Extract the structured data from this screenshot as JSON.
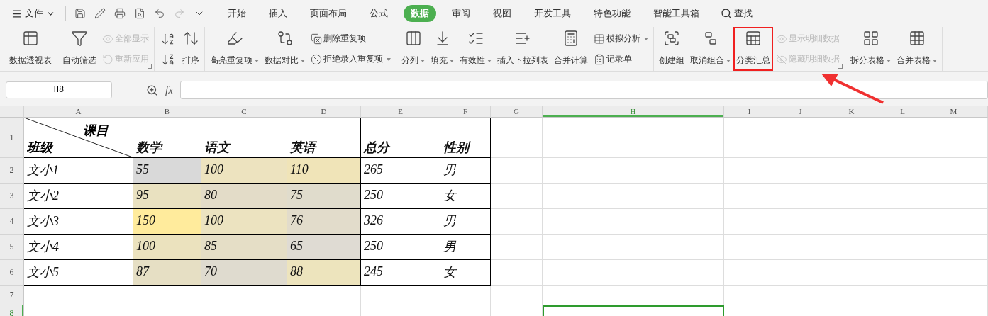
{
  "menu": {
    "file": "文件"
  },
  "quick_access": [
    {
      "disabled": false
    },
    {
      "disabled": false
    },
    {
      "disabled": false
    },
    {
      "disabled": false
    },
    {
      "disabled": false
    },
    {
      "disabled": true
    },
    {
      "disabled": false
    }
  ],
  "tabs": [
    {
      "label": "开始",
      "selected": false
    },
    {
      "label": "插入",
      "selected": false
    },
    {
      "label": "页面布局",
      "selected": false
    },
    {
      "label": "公式",
      "selected": false
    },
    {
      "label": "数据",
      "selected": true
    },
    {
      "label": "审阅",
      "selected": false
    },
    {
      "label": "视图",
      "selected": false
    },
    {
      "label": "开发工具",
      "selected": false
    },
    {
      "label": "特色功能",
      "selected": false
    },
    {
      "label": "智能工具箱",
      "selected": false
    }
  ],
  "search": {
    "label": "查找"
  },
  "ribbon": {
    "groups": [
      {
        "launcher": false,
        "columns": [
          {
            "kind": "large",
            "label": "数据透视表",
            "dropdown": false,
            "highlighted": false
          }
        ]
      },
      {
        "launcher": true,
        "columns": [
          {
            "kind": "large",
            "label": "自动筛选",
            "dropdown": false,
            "highlighted": false
          },
          {
            "kind": "stack",
            "items": [
              {
                "label": "全部显示",
                "disabled": true,
                "dropdown": false
              },
              {
                "label": "重新应用",
                "disabled": true,
                "dropdown": false
              }
            ]
          }
        ]
      },
      {
        "launcher": false,
        "columns": [
          {
            "kind": "icons",
            "items": [
              {
                "disabled": false
              },
              {
                "disabled": false
              }
            ]
          },
          {
            "kind": "large",
            "label": "排序",
            "dropdown": false,
            "highlighted": false
          }
        ]
      },
      {
        "launcher": false,
        "columns": [
          {
            "kind": "large",
            "label": "高亮重复项",
            "dropdown": true,
            "highlighted": false
          },
          {
            "kind": "large",
            "label": "数据对比",
            "dropdown": true,
            "highlighted": false
          },
          {
            "kind": "stack",
            "items": [
              {
                "label": "删除重复项",
                "disabled": false,
                "dropdown": false
              },
              {
                "label": "拒绝录入重复项",
                "disabled": false,
                "dropdown": true
              }
            ]
          }
        ]
      },
      {
        "launcher": false,
        "columns": [
          {
            "kind": "large",
            "label": "分列",
            "dropdown": true,
            "highlighted": false
          },
          {
            "kind": "large",
            "label": "填充",
            "dropdown": true,
            "highlighted": false
          },
          {
            "kind": "large",
            "label": "有效性",
            "dropdown": true,
            "highlighted": false
          },
          {
            "kind": "large",
            "label": "插入下拉列表",
            "dropdown": false,
            "highlighted": false
          },
          {
            "kind": "large",
            "label": "合并计算",
            "dropdown": false,
            "highlighted": false
          },
          {
            "kind": "stack",
            "items": [
              {
                "label": "模拟分析",
                "disabled": false,
                "dropdown": true
              },
              {
                "label": "记录单",
                "disabled": false,
                "dropdown": false
              }
            ]
          }
        ]
      },
      {
        "launcher": true,
        "columns": [
          {
            "kind": "large",
            "label": "创建组",
            "dropdown": false,
            "highlighted": false
          },
          {
            "kind": "large",
            "label": "取消组合",
            "dropdown": true,
            "highlighted": false
          },
          {
            "kind": "large",
            "label": "分类汇总",
            "dropdown": false,
            "highlighted": true
          },
          {
            "kind": "stack",
            "items": [
              {
                "label": "显示明细数据",
                "disabled": true,
                "dropdown": false
              },
              {
                "label": "隐藏明细数据",
                "disabled": true,
                "dropdown": false
              }
            ]
          }
        ]
      },
      {
        "launcher": false,
        "columns": [
          {
            "kind": "large",
            "label": "拆分表格",
            "dropdown": true,
            "highlighted": false
          },
          {
            "kind": "large",
            "label": "合并表格",
            "dropdown": true,
            "highlighted": false
          }
        ]
      }
    ]
  },
  "formula_bar": {
    "name_box": "H8",
    "fx": "fx"
  },
  "sheet": {
    "columns": [
      {
        "label": "A",
        "selected": false
      },
      {
        "label": "B",
        "selected": false
      },
      {
        "label": "C",
        "selected": false
      },
      {
        "label": "D",
        "selected": false
      },
      {
        "label": "E",
        "selected": false
      },
      {
        "label": "F",
        "selected": false
      },
      {
        "label": "G",
        "selected": false
      },
      {
        "label": "H",
        "selected": true
      },
      {
        "label": "I",
        "selected": false
      },
      {
        "label": "J",
        "selected": false
      },
      {
        "label": "K",
        "selected": false
      },
      {
        "label": "L",
        "selected": false
      },
      {
        "label": "M",
        "selected": false
      }
    ],
    "rows": [
      {
        "number": "1",
        "selected": false,
        "cells": [
          {
            "kind": "diagonal",
            "top_right": "课目",
            "bottom_left": "班级"
          },
          {
            "text": "数学"
          },
          {
            "text": "语文"
          },
          {
            "text": "英语"
          },
          {
            "text": "总分"
          },
          {
            "text": "性别"
          }
        ]
      },
      {
        "number": "2",
        "selected": false,
        "cells": [
          {
            "text": "文小1"
          },
          {
            "text": "55",
            "color": "#d9d9d9"
          },
          {
            "text": "100",
            "color": "#ede3bf"
          },
          {
            "text": "110",
            "color": "#f0e4b8"
          },
          {
            "text": "265"
          },
          {
            "text": "男"
          }
        ]
      },
      {
        "number": "3",
        "selected": false,
        "cells": [
          {
            "text": "文小2"
          },
          {
            "text": "95",
            "color": "#e9e1c0"
          },
          {
            "text": "80",
            "color": "#e3dcc8"
          },
          {
            "text": "75",
            "color": "#e0dccc"
          },
          {
            "text": "250"
          },
          {
            "text": "女"
          }
        ]
      },
      {
        "number": "4",
        "selected": false,
        "cells": [
          {
            "text": "文小3"
          },
          {
            "text": "150",
            "color": "#ffeb9c"
          },
          {
            "text": "100",
            "color": "#ece3c0"
          },
          {
            "text": "76",
            "color": "#e2dccb"
          },
          {
            "text": "326"
          },
          {
            "text": "男"
          }
        ]
      },
      {
        "number": "5",
        "selected": false,
        "cells": [
          {
            "text": "文小4"
          },
          {
            "text": "100",
            "color": "#ebe2be"
          },
          {
            "text": "85",
            "color": "#e5dec6"
          },
          {
            "text": "65",
            "color": "#dfdbd3"
          },
          {
            "text": "250"
          },
          {
            "text": "男"
          }
        ]
      },
      {
        "number": "6",
        "selected": false,
        "cells": [
          {
            "text": "文小5"
          },
          {
            "text": "87",
            "color": "#e6dfc4"
          },
          {
            "text": "70",
            "color": "#dfdbcf"
          },
          {
            "text": "88",
            "color": "#ede4bd"
          },
          {
            "text": "245"
          },
          {
            "text": "女"
          }
        ]
      },
      {
        "number": "7",
        "selected": false,
        "cells": []
      },
      {
        "number": "8",
        "selected": true,
        "cells": []
      }
    ]
  }
}
